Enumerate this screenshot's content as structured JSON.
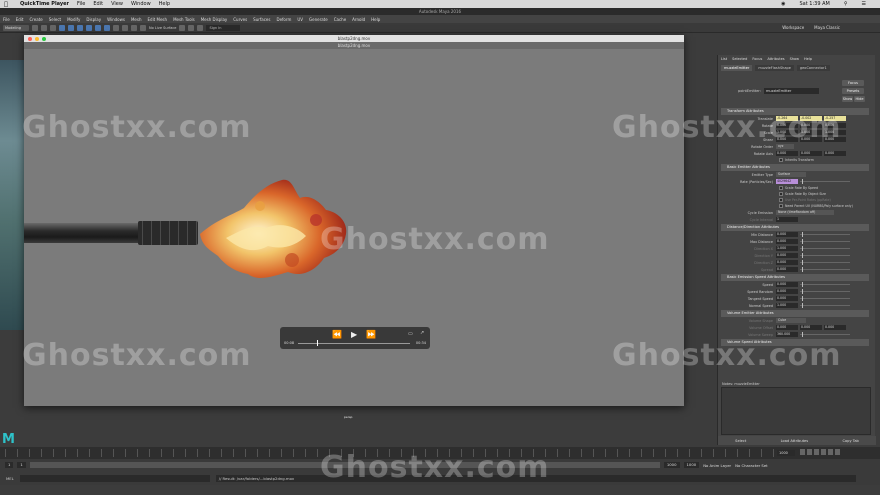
{
  "macbar": {
    "app": "QuickTime Player",
    "menus": [
      "File",
      "Edit",
      "View",
      "Window",
      "Help"
    ],
    "time": "Sat 1:39 AM"
  },
  "maya": {
    "title": "Autodesk Maya 2016",
    "menus": [
      "File",
      "Edit",
      "Create",
      "Select",
      "Modify",
      "Display",
      "Windows",
      "Mesh",
      "Edit Mesh",
      "Mesh Tools",
      "Mesh Display",
      "Curves",
      "Surfaces",
      "Deform",
      "UV",
      "Generate",
      "Cache",
      "Arnold",
      "Help"
    ],
    "mode_dropdown": "Modeling",
    "live_surface": "No Live Surface",
    "sign_in": "Sign In",
    "workspace_label": "Workspace",
    "workspace_value": "Maya Classic"
  },
  "quicktime": {
    "window_title": "blastp2dng.mov",
    "sub_title": "blastp2dng.mov",
    "current_time": "00:08",
    "duration": "00:34",
    "camera_label": "persp"
  },
  "attribute_editor": {
    "menus": [
      "List",
      "Selected",
      "Focus",
      "Attributes",
      "Show",
      "Help"
    ],
    "tabs": [
      "muzzleEmitter",
      "muzzleFlashShape",
      "geoConnector1"
    ],
    "name_label": "pointEmitter:",
    "name_value": "muzzleEmitter",
    "focus_label": "Focus",
    "presets_label": "Presets",
    "show_label": "Show",
    "hide_label": "Hide",
    "sections": {
      "transform": "Transform Attributes",
      "basic_emitter": "Basic Emitter Attributes",
      "distance_direction": "Distance/Direction Attributes",
      "basic_speed": "Basic Emission Speed Attributes",
      "volume_emitter": "Volume Emitter Attributes",
      "volume_speed": "Volume Speed Attributes"
    },
    "transform": {
      "translate_label": "Translate",
      "translate": [
        "-0.264",
        "-0.002",
        "-0.257"
      ],
      "rotate_label": "Rotate",
      "rotate": [
        "0.000",
        "0.000",
        "0.000"
      ],
      "scale_label": "Scale",
      "scale": [
        "1.000",
        "1.000",
        "1.000"
      ],
      "shear_label": "Shear",
      "shear": [
        "0.000",
        "0.000",
        "0.000"
      ],
      "rotate_order_label": "Rotate Order",
      "rotate_order": "xyz",
      "rotate_axis_label": "Rotate Axis",
      "rotate_axis": [
        "0.000",
        "0.000",
        "0.000"
      ],
      "inherits_label": "Inherits Transform"
    },
    "basic": {
      "emitter_type_label": "Emitter Type",
      "emitter_type": "Surface",
      "rate_label": "Rate (Particles/Sec)",
      "rate": "4029642",
      "checks": [
        "Scale Rate By Speed",
        "Scale Rate By Object Size",
        "Use Per-Point Rates (ppRate)",
        "Need Parent UV (NURBS/Poly surface only)"
      ],
      "cycle_label": "Cycle Emission",
      "cycle_value": "None (timeRandom off)",
      "cycle_interval_label": "Cycle Interval",
      "cycle_interval": "1"
    },
    "distance": {
      "min_label": "Min Distance",
      "min": "0.000",
      "max_label": "Max Distance",
      "max": "0.000",
      "dir_x_label": "Direction X",
      "dir_x": "1.000",
      "dir_y_label": "Direction Y",
      "dir_y": "0.000",
      "dir_z_label": "Direction Z",
      "dir_z": "0.000",
      "spread_label": "Spread",
      "spread": "0.000"
    },
    "speed": {
      "speed_label": "Speed",
      "speed": "0.000",
      "speed_random_label": "Speed Random",
      "speed_random": "0.000",
      "tangent_label": "Tangent Speed",
      "tangent": "0.000",
      "normal_label": "Normal Speed",
      "normal": "1.000"
    },
    "volume": {
      "shape_label": "Volume Shape",
      "shape": "Cube",
      "offset_label": "Volume Offset",
      "offset": [
        "0.000",
        "0.000",
        "0.000"
      ],
      "sweep_label": "Volume Sweep",
      "sweep": "360.000"
    },
    "notes_label": "Notes: muzzleEmitter",
    "select_label": "Select",
    "load_label": "Load Attributes",
    "copy_label": "Copy Tab"
  },
  "timeline": {
    "current_frame": "1000",
    "range_start": "1",
    "range_start2": "1",
    "range_end": "1000",
    "range_end2": "1000",
    "anim_layer": "No Anim Layer",
    "character_set": "No Character Set"
  },
  "command": {
    "label": "MEL",
    "result": "// Result: /var/folders/...blastp2dng.mov"
  },
  "watermark": "Ghostxx.com"
}
